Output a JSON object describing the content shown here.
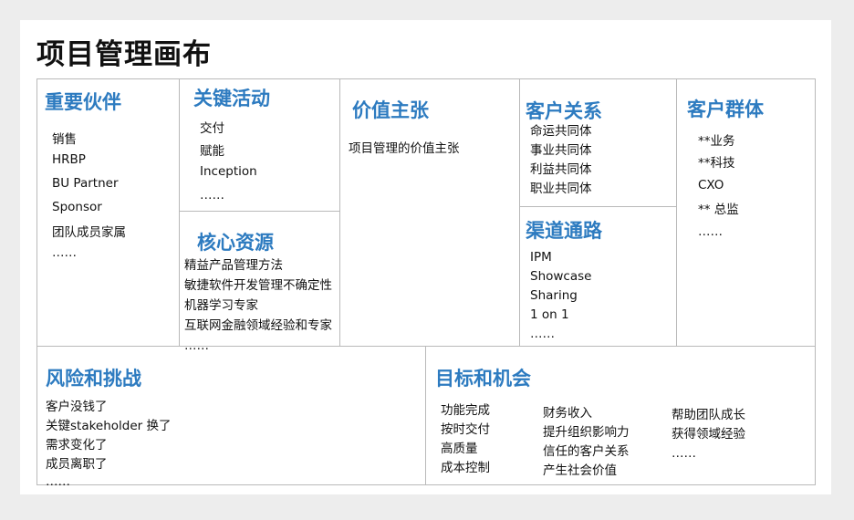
{
  "title": "项目管理画布",
  "sections": {
    "key_partners": {
      "heading": "重要伙伴",
      "items": [
        "销售",
        "HRBP",
        "BU Partner",
        "Sponsor",
        "团队成员家属",
        "……"
      ]
    },
    "key_activities": {
      "heading": "关键活动",
      "items": [
        "交付",
        "赋能",
        "Inception",
        "……"
      ]
    },
    "key_resources": {
      "heading": "核心资源",
      "items": [
        "精益产品管理方法",
        "敏捷软件开发管理不确定性",
        "机器学习专家",
        "互联网金融领域经验和专家",
        "……"
      ]
    },
    "value_proposition": {
      "heading": "价值主张",
      "items": [
        "项目管理的价值主张"
      ]
    },
    "customer_relationships": {
      "heading": "客户关系",
      "items": [
        "命运共同体",
        "事业共同体",
        "利益共同体",
        "职业共同体"
      ]
    },
    "channels": {
      "heading": "渠道通路",
      "items": [
        "IPM",
        "Showcase",
        "Sharing",
        "1 on 1",
        "……"
      ]
    },
    "customer_segments": {
      "heading": "客户群体",
      "items": [
        "**业务",
        "**科技",
        "CXO",
        "** 总监",
        "……"
      ]
    },
    "risks": {
      "heading": "风险和挑战",
      "items": [
        "客户没钱了",
        "关键stakeholder 换了",
        "需求变化了",
        "成员离职了",
        "……"
      ]
    },
    "goals": {
      "heading": "目标和机会",
      "col1": [
        "功能完成",
        "按时交付",
        "高质量",
        "成本控制"
      ],
      "col2": [
        "财务收入",
        "提升组织影响力",
        "信任的客户关系",
        "产生社会价值"
      ],
      "col3": [
        "帮助团队成长",
        "获得领域经验",
        "……"
      ]
    }
  }
}
